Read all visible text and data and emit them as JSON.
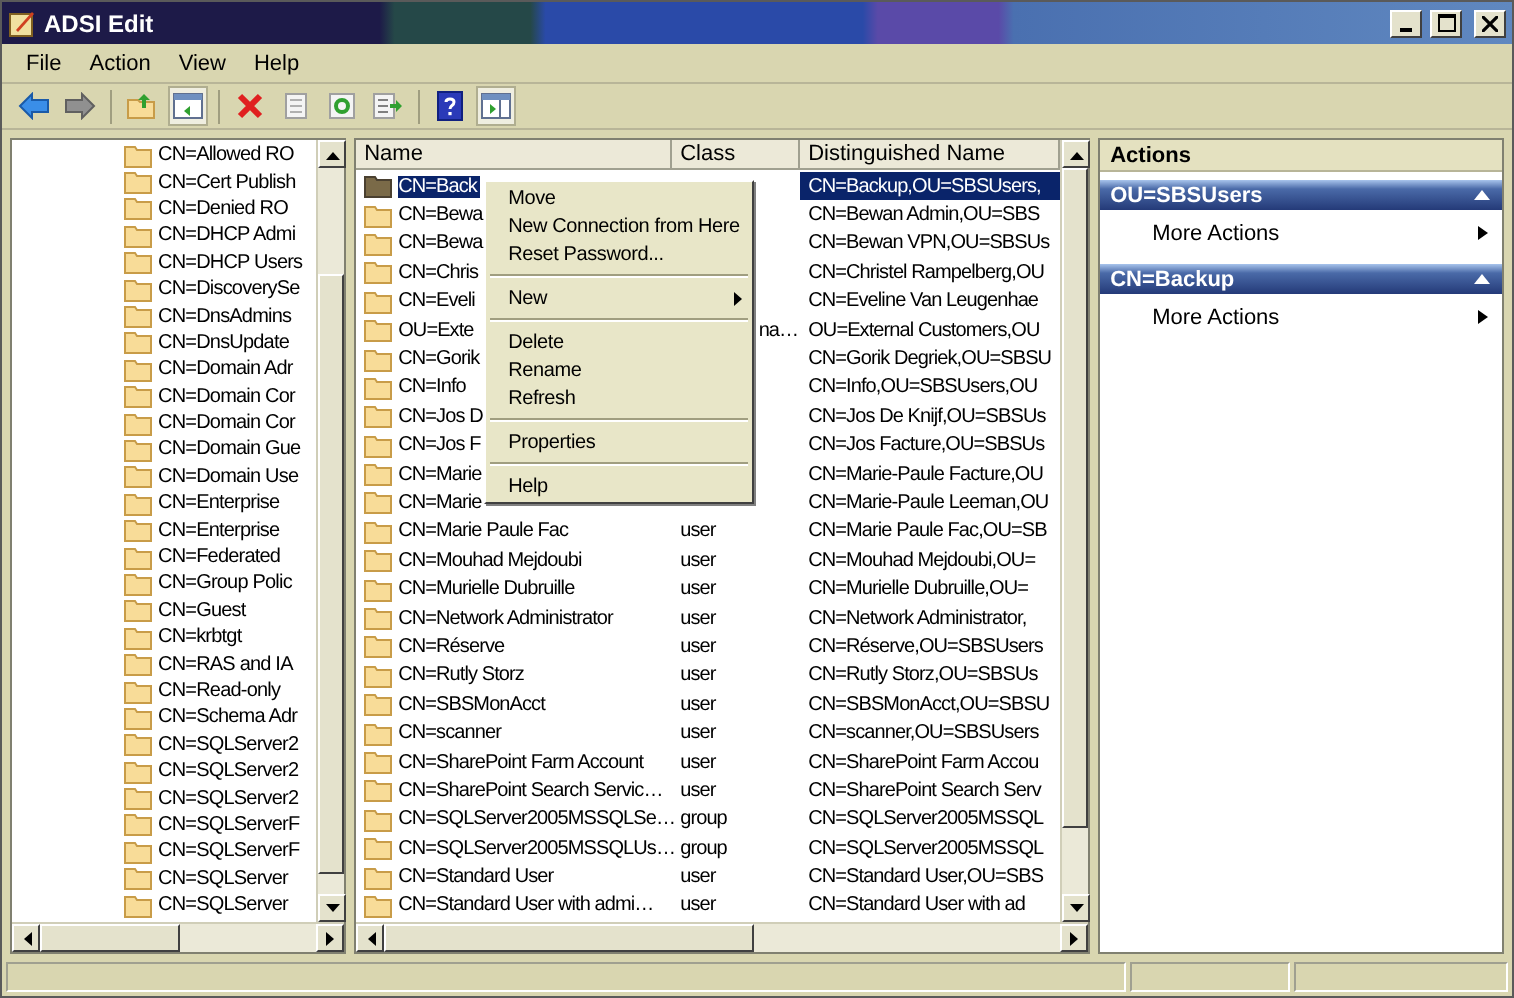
{
  "window": {
    "title": "ADSI Edit"
  },
  "menu": [
    "File",
    "Action",
    "View",
    "Help"
  ],
  "tree": {
    "items": [
      {
        "label": "CN=Allowed RO"
      },
      {
        "label": "CN=Cert Publish"
      },
      {
        "label": "CN=Denied RO"
      },
      {
        "label": "CN=DHCP Admi"
      },
      {
        "label": "CN=DHCP Users"
      },
      {
        "label": "CN=DiscoverySe"
      },
      {
        "label": "CN=DnsAdmins"
      },
      {
        "label": "CN=DnsUpdate"
      },
      {
        "label": "CN=Domain Adr"
      },
      {
        "label": "CN=Domain Cor"
      },
      {
        "label": "CN=Domain Cor"
      },
      {
        "label": "CN=Domain Gue"
      },
      {
        "label": "CN=Domain Use"
      },
      {
        "label": "CN=Enterprise"
      },
      {
        "label": "CN=Enterprise"
      },
      {
        "label": "CN=Federated"
      },
      {
        "label": "CN=Group Polic"
      },
      {
        "label": "CN=Guest"
      },
      {
        "label": "CN=krbtgt"
      },
      {
        "label": "CN=RAS and IA"
      },
      {
        "label": "CN=Read-only"
      },
      {
        "label": "CN=Schema Adr"
      },
      {
        "label": "CN=SQLServer2"
      },
      {
        "label": "CN=SQLServer2"
      },
      {
        "label": "CN=SQLServer2"
      },
      {
        "label": "CN=SQLServerF"
      },
      {
        "label": "CN=SQLServerF"
      },
      {
        "label": "CN=SQLServer"
      },
      {
        "label": "CN=SQLServer"
      }
    ]
  },
  "list": {
    "columns": [
      "Name",
      "Class",
      "Distinguished Name"
    ],
    "rows": [
      {
        "name": "CN=Back",
        "dn": "CN=Backup,OU=SBSUsers,",
        "selected": true
      },
      {
        "name": "CN=Bewa",
        "dn": "CN=Bewan Admin,OU=SBS",
        "selected": false
      },
      {
        "name": "CN=Bewa",
        "dn": "CN=Bewan VPN,OU=SBSUs",
        "selected": false
      },
      {
        "name": "CN=Chris",
        "dn": "CN=Christel Rampelberg,OU",
        "selected": false
      },
      {
        "name": "CN=Eveli",
        "dn": "CN=Eveline Van Leugenhae",
        "selected": false
      },
      {
        "name": "OU=Exte",
        "class": "na…",
        "class_partial": true,
        "dn": "OU=External Customers,OU",
        "selected": false
      },
      {
        "name": "CN=Gorik",
        "dn": "CN=Gorik Degriek,OU=SBSU",
        "selected": false
      },
      {
        "name": "CN=Info",
        "dn": "CN=Info,OU=SBSUsers,OU",
        "selected": false
      },
      {
        "name": "CN=Jos D",
        "dn": "CN=Jos De Knijf,OU=SBSUs",
        "selected": false
      },
      {
        "name": "CN=Jos F",
        "dn": "CN=Jos Facture,OU=SBSUs",
        "selected": false
      },
      {
        "name": "CN=Marie",
        "dn": "CN=Marie-Paule Facture,OU",
        "selected": false
      },
      {
        "name": "CN=Marie",
        "dn": "CN=Marie-Paule Leeman,OU",
        "selected": false
      },
      {
        "name": "CN=Marie Paule Fac",
        "class": "user",
        "dn": "CN=Marie Paule Fac,OU=SB",
        "selected": false
      },
      {
        "name": "CN=Mouhad Mejdoubi",
        "class": "user",
        "dn": "CN=Mouhad Mejdoubi,OU=",
        "selected": false
      },
      {
        "name": "CN=Murielle Dubruille",
        "class": "user",
        "dn": "CN=Murielle Dubruille,OU=",
        "selected": false
      },
      {
        "name": "CN=Network Administrator",
        "class": "user",
        "dn": "CN=Network Administrator,",
        "selected": false
      },
      {
        "name": "CN=Réserve",
        "class": "user",
        "dn": "CN=Réserve,OU=SBSUsers",
        "selected": false
      },
      {
        "name": "CN=Rutly Storz",
        "class": "user",
        "dn": "CN=Rutly Storz,OU=SBSUs",
        "selected": false
      },
      {
        "name": "CN=SBSMonAcct",
        "class": "user",
        "dn": "CN=SBSMonAcct,OU=SBSU",
        "selected": false
      },
      {
        "name": "CN=scanner",
        "class": "user",
        "dn": "CN=scanner,OU=SBSUsers",
        "selected": false
      },
      {
        "name": "CN=SharePoint Farm Account",
        "class": "user",
        "dn": "CN=SharePoint Farm Accou",
        "selected": false
      },
      {
        "name": "CN=SharePoint Search Servic…",
        "class": "user",
        "dn": "CN=SharePoint Search Serv",
        "selected": false
      },
      {
        "name": "CN=SQLServer2005MSSQLSe…",
        "class": "group",
        "dn": "CN=SQLServer2005MSSQL",
        "selected": false
      },
      {
        "name": "CN=SQLServer2005MSSQLUs…",
        "class": "group",
        "dn": "CN=SQLServer2005MSSQL",
        "selected": false
      },
      {
        "name": "CN=Standard User",
        "class": "user",
        "dn": "CN=Standard User,OU=SBS",
        "selected": false
      },
      {
        "name": "CN=Standard User with admi…",
        "class": "user",
        "dn": "CN=Standard User with ad",
        "selected": false
      }
    ]
  },
  "context_menu": {
    "items": [
      {
        "kind": "item",
        "label": "Move"
      },
      {
        "kind": "item",
        "label": "New Connection from Here"
      },
      {
        "kind": "item",
        "label": "Reset Password..."
      },
      {
        "kind": "separator"
      },
      {
        "kind": "submenu",
        "label": "New"
      },
      {
        "kind": "separator"
      },
      {
        "kind": "item",
        "label": "Delete"
      },
      {
        "kind": "item",
        "label": "Rename"
      },
      {
        "kind": "item",
        "label": "Refresh"
      },
      {
        "kind": "separator"
      },
      {
        "kind": "item",
        "label": "Properties"
      },
      {
        "kind": "separator"
      },
      {
        "kind": "item",
        "label": "Help"
      }
    ]
  },
  "actions": {
    "title": "Actions",
    "groups": [
      {
        "title": "OU=SBSUsers",
        "items": [
          "More Actions"
        ]
      },
      {
        "title": "CN=Backup",
        "items": [
          "More Actions"
        ]
      }
    ]
  }
}
